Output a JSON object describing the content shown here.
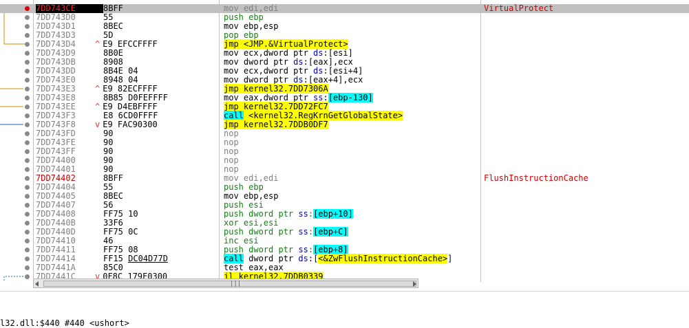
{
  "disassembly": {
    "rows": [
      {
        "addr": "7DD743CE",
        "bytes": "8BFF",
        "jmark": "",
        "instr": [
          {
            "t": "mov edi,edi",
            "c": "kw-nop"
          }
        ],
        "comment": "VirtualProtect",
        "sel": true,
        "cip": true,
        "label": true
      },
      {
        "addr": "7DD743D0",
        "bytes": "55",
        "jmark": "",
        "instr": [
          {
            "t": "push ",
            "c": "kw-push"
          },
          {
            "t": "ebp",
            "c": "kw-push"
          }
        ],
        "comment": ""
      },
      {
        "addr": "7DD743D1",
        "bytes": "8BEC",
        "jmark": "",
        "instr": [
          {
            "t": "mov ebp,esp",
            "c": "kw-mov"
          }
        ],
        "comment": ""
      },
      {
        "addr": "7DD743D3",
        "bytes": "5D",
        "jmark": "",
        "instr": [
          {
            "t": "pop ebp",
            "c": "kw-pop"
          }
        ],
        "comment": ""
      },
      {
        "addr": "7DD743D4",
        "bytes": "E9 EFCCFFFF",
        "jmark": "^",
        "instr": [
          {
            "t": "jmp <JMP.&VirtualProtect>",
            "c": "kw-jmp"
          }
        ],
        "comment": ""
      },
      {
        "addr": "7DD743D9",
        "bytes": "8B0E",
        "jmark": "",
        "instr": [
          {
            "t": "mov ecx,dword ptr ",
            "c": "kw-mov"
          },
          {
            "t": "ds",
            "c": "seg"
          },
          {
            "t": ":[esi]",
            "c": "kw-mov"
          }
        ],
        "comment": ""
      },
      {
        "addr": "7DD743DB",
        "bytes": "8908",
        "jmark": "",
        "instr": [
          {
            "t": "mov dword ptr ",
            "c": "kw-mov"
          },
          {
            "t": "ds",
            "c": "seg"
          },
          {
            "t": ":[eax],ecx",
            "c": "kw-mov"
          }
        ],
        "comment": ""
      },
      {
        "addr": "7DD743DD",
        "bytes": "8B4E 04",
        "jmark": "",
        "instr": [
          {
            "t": "mov ecx,dword ptr ",
            "c": "kw-mov"
          },
          {
            "t": "ds",
            "c": "seg"
          },
          {
            "t": ":[esi+4]",
            "c": "kw-mov"
          }
        ],
        "comment": ""
      },
      {
        "addr": "7DD743E0",
        "bytes": "8948 04",
        "jmark": "",
        "instr": [
          {
            "t": "mov dword ptr ",
            "c": "kw-mov"
          },
          {
            "t": "ds",
            "c": "seg"
          },
          {
            "t": ":[eax+4],ecx",
            "c": "kw-mov"
          }
        ],
        "comment": ""
      },
      {
        "addr": "7DD743E3",
        "bytes": "E9 82ECFFFF",
        "jmark": "^",
        "instr": [
          {
            "t": "jmp kernel32.7DD7306A",
            "c": "kw-jmp"
          }
        ],
        "comment": ""
      },
      {
        "addr": "7DD743E8",
        "bytes": "8B85 D0FEFFFF",
        "jmark": "",
        "instr": [
          {
            "t": "mov eax,dword ptr ",
            "c": "kw-mov"
          },
          {
            "t": "ss",
            "c": "seg"
          },
          {
            "t": ":",
            "c": "kw-mov"
          },
          {
            "t": "[ebp-130]",
            "c": "bracket"
          }
        ],
        "comment": ""
      },
      {
        "addr": "7DD743EE",
        "bytes": "E9 D4EBFFFF",
        "jmark": "^",
        "instr": [
          {
            "t": "jmp kernel32.7DD72FC7",
            "c": "kw-jmp"
          }
        ],
        "comment": ""
      },
      {
        "addr": "7DD743F3",
        "bytes": "E8 6CD0FFFF",
        "jmark": "",
        "instr": [
          {
            "t": "call",
            "c": "kw-call"
          },
          {
            "t": " <kernel32.RegKrnGetGlobalState>",
            "c": "kw-jmp"
          }
        ],
        "comment": ""
      },
      {
        "addr": "7DD743F8",
        "bytes": "E9 FAC90300",
        "jmark": "v",
        "instr": [
          {
            "t": "jmp kernel32.7DDB0DF7",
            "c": "kw-jmp"
          }
        ],
        "comment": ""
      },
      {
        "addr": "7DD743FD",
        "bytes": "90",
        "jmark": "",
        "instr": [
          {
            "t": "nop",
            "c": "kw-nop"
          }
        ],
        "comment": ""
      },
      {
        "addr": "7DD743FE",
        "bytes": "90",
        "jmark": "",
        "instr": [
          {
            "t": "nop",
            "c": "kw-nop"
          }
        ],
        "comment": ""
      },
      {
        "addr": "7DD743FF",
        "bytes": "90",
        "jmark": "",
        "instr": [
          {
            "t": "nop",
            "c": "kw-nop"
          }
        ],
        "comment": ""
      },
      {
        "addr": "7DD74400",
        "bytes": "90",
        "jmark": "",
        "instr": [
          {
            "t": "nop",
            "c": "kw-nop"
          }
        ],
        "comment": ""
      },
      {
        "addr": "7DD74401",
        "bytes": "90",
        "jmark": "",
        "instr": [
          {
            "t": "nop",
            "c": "kw-nop"
          }
        ],
        "comment": ""
      },
      {
        "addr": "7DD74402",
        "bytes": "8BFF",
        "jmark": "",
        "instr": [
          {
            "t": "mov edi,edi",
            "c": "kw-nop"
          }
        ],
        "comment": "FlushInstructionCache",
        "label": true
      },
      {
        "addr": "7DD74404",
        "bytes": "55",
        "jmark": "",
        "instr": [
          {
            "t": "push ebp",
            "c": "kw-push"
          }
        ],
        "comment": ""
      },
      {
        "addr": "7DD74405",
        "bytes": "8BEC",
        "jmark": "",
        "instr": [
          {
            "t": "mov ebp,esp",
            "c": "kw-mov"
          }
        ],
        "comment": ""
      },
      {
        "addr": "7DD74407",
        "bytes": "56",
        "jmark": "",
        "instr": [
          {
            "t": "push esi",
            "c": "kw-push"
          }
        ],
        "comment": ""
      },
      {
        "addr": "7DD74408",
        "bytes": "FF75 10",
        "jmark": "",
        "instr": [
          {
            "t": "push dword ptr ",
            "c": "kw-push"
          },
          {
            "t": "ss",
            "c": "seg"
          },
          {
            "t": ":",
            "c": "kw-push"
          },
          {
            "t": "[ebp+10]",
            "c": "bracket"
          }
        ],
        "comment": ""
      },
      {
        "addr": "7DD7440B",
        "bytes": "33F6",
        "jmark": "",
        "instr": [
          {
            "t": "xor esi,esi",
            "c": "kw-xor"
          }
        ],
        "comment": ""
      },
      {
        "addr": "7DD7440D",
        "bytes": "FF75 0C",
        "jmark": "",
        "instr": [
          {
            "t": "push dword ptr ",
            "c": "kw-push"
          },
          {
            "t": "ss",
            "c": "seg"
          },
          {
            "t": ":",
            "c": "kw-push"
          },
          {
            "t": "[ebp+C]",
            "c": "bracket"
          }
        ],
        "comment": ""
      },
      {
        "addr": "7DD74410",
        "bytes": "46",
        "jmark": "",
        "instr": [
          {
            "t": "inc esi",
            "c": "kw-inc"
          }
        ],
        "comment": ""
      },
      {
        "addr": "7DD74411",
        "bytes": "FF75 08",
        "jmark": "",
        "instr": [
          {
            "t": "push dword ptr ",
            "c": "kw-push"
          },
          {
            "t": "ss",
            "c": "seg"
          },
          {
            "t": ":",
            "c": "kw-push"
          },
          {
            "t": "[ebp+8]",
            "c": "bracket"
          }
        ],
        "comment": ""
      },
      {
        "addr": "7DD74414",
        "bytes": "FF15 DC04D77D",
        "jmark": "",
        "underline": "DC04D77D",
        "instr": [
          {
            "t": "call",
            "c": "kw-call"
          },
          {
            "t": " dword ptr ",
            "c": "kw-mov"
          },
          {
            "t": "ds",
            "c": "seg"
          },
          {
            "t": ":[",
            "c": "kw-mov"
          },
          {
            "t": "<&ZwFlushInstructionCache>",
            "c": "kw-jmp"
          },
          {
            "t": "]",
            "c": "kw-mov"
          }
        ],
        "comment": ""
      },
      {
        "addr": "7DD7441A",
        "bytes": "85C0",
        "jmark": "",
        "instr": [
          {
            "t": "test eax,eax",
            "c": "kw-test"
          }
        ],
        "comment": ""
      },
      {
        "addr": "7DD7441C",
        "bytes": "0F8C 179F0300",
        "jmark": "v",
        "instr": [
          {
            "t": "jl kernel32.7DDB0339",
            "c": "kw-jl"
          }
        ],
        "comment": ""
      }
    ]
  },
  "scrollbar": {
    "grip": "|||"
  },
  "bottom": {
    "info": "l32.dll:$440 #440 <ushort>"
  },
  "colors": {
    "jump_yellow": "#ffff00",
    "call_cyan": "#00ffff",
    "label_red": "#d00000",
    "push_green": "#1a7a1a",
    "selection": "#c0c0c0"
  }
}
